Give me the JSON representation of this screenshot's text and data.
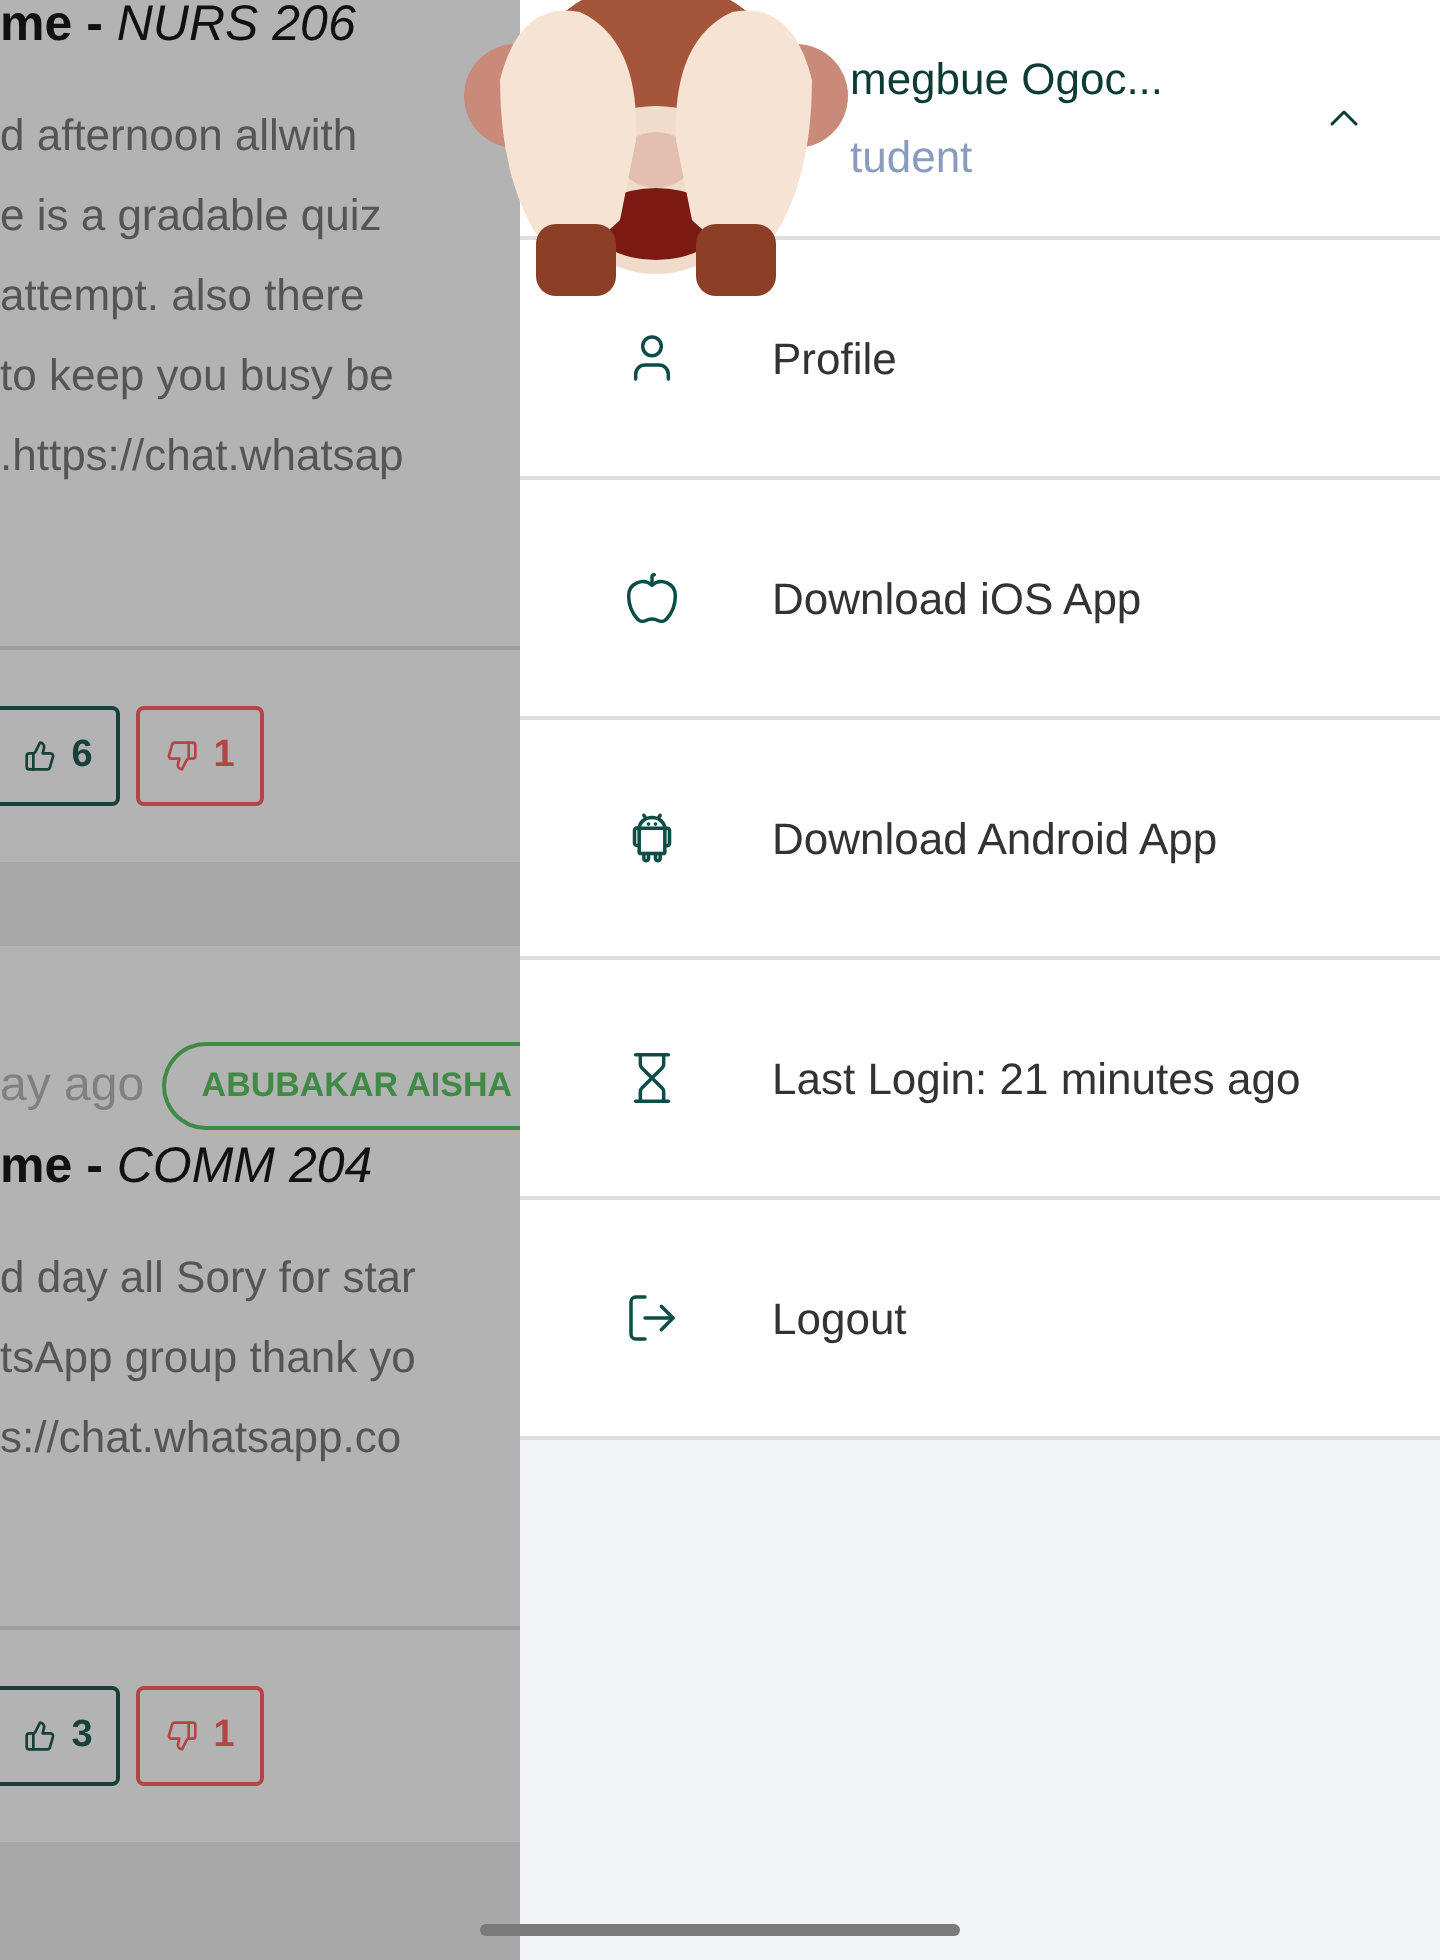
{
  "feed": [
    {
      "title": "**me -** *NURS 206*",
      "body": [
        "d afternoon allwith",
        "e is a gradable quiz",
        "attempt. also there",
        "to keep you busy be",
        ".https://chat.whatsap"
      ],
      "likes": "6",
      "dislikes": "1"
    },
    {
      "meta": "ay ago",
      "badge": "ABUBAKAR AISHA",
      "title": "**me -** *COMM 204*",
      "body": [
        "d day all Sory for star",
        "tsApp group thank yo",
        "s://chat.whatsapp.co"
      ],
      "likes": "3",
      "dislikes": "1"
    }
  ],
  "drawer": {
    "user": {
      "name": "megbue Ogoc...",
      "role": "tudent",
      "expanded": true
    },
    "items": [
      {
        "kind": "profile",
        "label": "Profile"
      },
      {
        "kind": "ios",
        "label": "Download iOS App"
      },
      {
        "kind": "android",
        "label": "Download Android App"
      },
      {
        "kind": "login",
        "label": "Last Login: 21 minutes ago"
      },
      {
        "kind": "logout",
        "label": "Logout"
      }
    ]
  }
}
